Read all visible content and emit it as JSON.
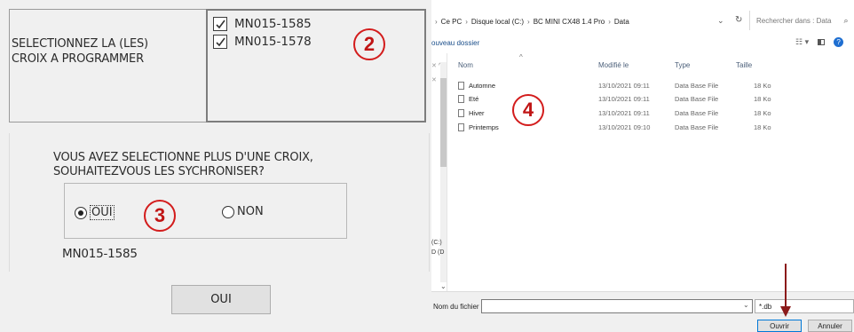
{
  "left_dialog": {
    "prompt": [
      "SELECTIONNEZ LA (LES)",
      "CROIX A PROGRAMMER"
    ],
    "checkboxes": [
      {
        "label": "MN015-1585",
        "checked": true
      },
      {
        "label": "MN015-1578",
        "checked": true
      }
    ],
    "annotation_2": "2",
    "question": [
      "VOUS AVEZ SELECTIONNE PLUS D'UNE CROIX,",
      "SOUHAITEZVOUS LES SYCHRONISER?"
    ],
    "radio_oui": "OUI",
    "radio_non": "NON",
    "selected_radio": "OUI",
    "annotation_3": "3",
    "selected_device": "MN015-1585",
    "ok_button": "OUI"
  },
  "explorer": {
    "breadcrumb": [
      "Ce PC",
      "Disque local (C:)",
      "BC MINI CX48 1.4 Pro",
      "Data"
    ],
    "search_placeholder": "Rechercher dans : Data",
    "new_folder": "ouveau dossier",
    "columns": [
      "Nom",
      "Modifié le",
      "Type",
      "Taille"
    ],
    "files": [
      {
        "name": "Automne",
        "modified": "13/10/2021 09:11",
        "type": "Data Base File",
        "size": "18 Ko"
      },
      {
        "name": "Eté",
        "modified": "13/10/2021 09:11",
        "type": "Data Base File",
        "size": "18 Ko"
      },
      {
        "name": "Hiver",
        "modified": "13/10/2021 09:11",
        "type": "Data Base File",
        "size": "18 Ko"
      },
      {
        "name": "Printemps",
        "modified": "13/10/2021 09:10",
        "type": "Data Base File",
        "size": "18 Ko"
      }
    ],
    "annotation_4": "4",
    "nav_fragments": [
      "(C:)",
      "D (D"
    ],
    "filename_label": "Nom du fichier :",
    "filename_value": "",
    "filter": "*.db",
    "open_button": "Ouvrir",
    "cancel_button": "Annuler"
  },
  "colors": {
    "annotation_red": "#d31c1c",
    "dialog_bg": "#f0f0f0",
    "link_blue": "#1a4e8a",
    "arrow_dark_red": "#8b1a1a"
  },
  "icons": [
    "checkbox-checked-icon",
    "radio-selected-icon",
    "radio-empty-icon",
    "file-icon",
    "refresh-icon",
    "chevron-down-icon",
    "search-icon",
    "view-options-icon",
    "preview-pane-icon",
    "help-icon",
    "pin-icon",
    "down-arrow-icon"
  ]
}
